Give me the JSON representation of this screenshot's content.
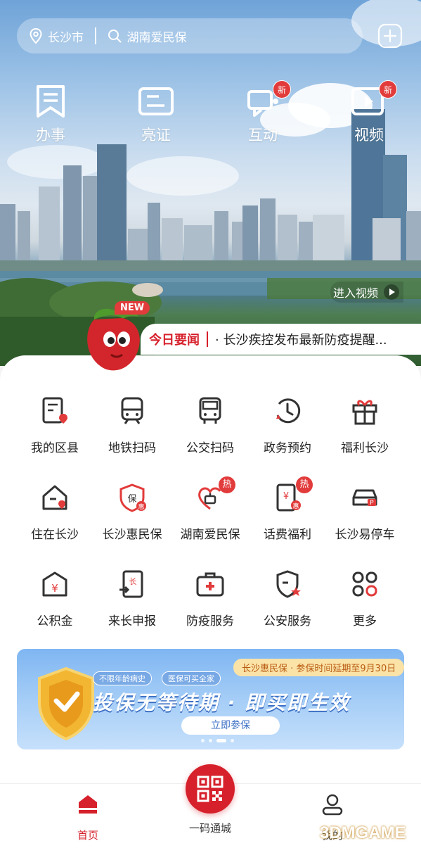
{
  "topbar": {
    "city": "长沙市",
    "search_text": "湖南爱民保"
  },
  "quick_actions": [
    {
      "label": "办事",
      "icon": "bookmark-icon",
      "badge": ""
    },
    {
      "label": "亮证",
      "icon": "id-card-icon",
      "badge": ""
    },
    {
      "label": "互动",
      "icon": "chat-icon",
      "badge": "新"
    },
    {
      "label": "视频",
      "icon": "video-icon",
      "badge": "新"
    }
  ],
  "video_entry": "进入视频",
  "news": {
    "tag": "NEW",
    "title": "今日要闻",
    "text": "· 长沙疾控发布最新防疫提醒..."
  },
  "grid": [
    {
      "label": "我的区县",
      "icon": "district-icon",
      "badge": ""
    },
    {
      "label": "地铁扫码",
      "icon": "metro-icon",
      "badge": ""
    },
    {
      "label": "公交扫码",
      "icon": "bus-icon",
      "badge": ""
    },
    {
      "label": "政务预约",
      "icon": "clock-icon",
      "badge": ""
    },
    {
      "label": "福利长沙",
      "icon": "gift-icon",
      "badge": ""
    },
    {
      "label": "住在长沙",
      "icon": "house-icon",
      "badge": ""
    },
    {
      "label": "长沙惠民保",
      "icon": "insurance-shield-icon",
      "badge": ""
    },
    {
      "label": "湖南爱民保",
      "icon": "heart-hand-icon",
      "badge": "热"
    },
    {
      "label": "话费福利",
      "icon": "phone-bill-icon",
      "badge": "热"
    },
    {
      "label": "长沙易停车",
      "icon": "car-icon",
      "badge": ""
    },
    {
      "label": "公积金",
      "icon": "fund-icon",
      "badge": ""
    },
    {
      "label": "来长申报",
      "icon": "declare-icon",
      "badge": ""
    },
    {
      "label": "防疫服务",
      "icon": "medical-kit-icon",
      "badge": ""
    },
    {
      "label": "公安服务",
      "icon": "police-shield-icon",
      "badge": ""
    },
    {
      "label": "更多",
      "icon": "more-apps-icon",
      "badge": ""
    }
  ],
  "banner": {
    "top_tag": "长沙惠民保 · 参保时间延期至9月30日",
    "chip1": "不限年龄病史",
    "chip2": "医保可买全家",
    "headline": "投保无等待期 · 即买即生效",
    "cta": "立即参保"
  },
  "tabbar": {
    "home": "首页",
    "qr": "一码通城",
    "mine": "我的"
  },
  "watermark": "3DMGAME",
  "colors": {
    "brand_red": "#d6202b",
    "badge_red": "#e23b3b",
    "banner_blue": "#7fb6f2"
  }
}
